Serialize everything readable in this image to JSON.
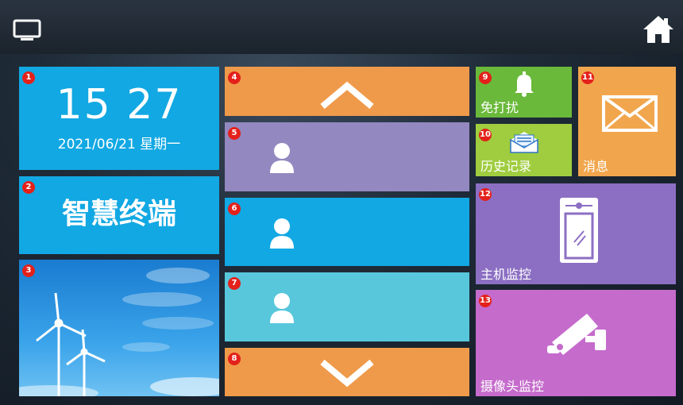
{
  "clock": {
    "time": "15 27",
    "date": "2021/06/21 星期一"
  },
  "brand": {
    "title": "智慧终端"
  },
  "badges": [
    "1",
    "2",
    "3",
    "4",
    "5",
    "6",
    "7",
    "8",
    "9",
    "10",
    "11",
    "12",
    "13"
  ],
  "tiles": {
    "dnd": "免打扰",
    "history": "历史记录",
    "message": "消息",
    "host_monitor": "主机监控",
    "camera_monitor": "摄像头监控"
  },
  "icons": {
    "top_left": "monitor-icon",
    "top_right": "home-icon",
    "scroll_up": "chevron-up-icon",
    "scroll_down": "chevron-down-icon",
    "contact": "user-icon",
    "dnd": "bell-icon",
    "history": "envelope-open-icon",
    "message": "envelope-icon",
    "host_monitor": "door-panel-icon",
    "camera_monitor": "cctv-camera-icon"
  },
  "colors": {
    "blue": "#12a8e3",
    "orange": "#ef9a4a",
    "purple": "#9488c0",
    "teal": "#58c7dc",
    "green": "#6ab93a",
    "lime": "#9fcd3f",
    "gold": "#f1a64d",
    "violet": "#8c6fc3",
    "magenta": "#c56bcc"
  }
}
